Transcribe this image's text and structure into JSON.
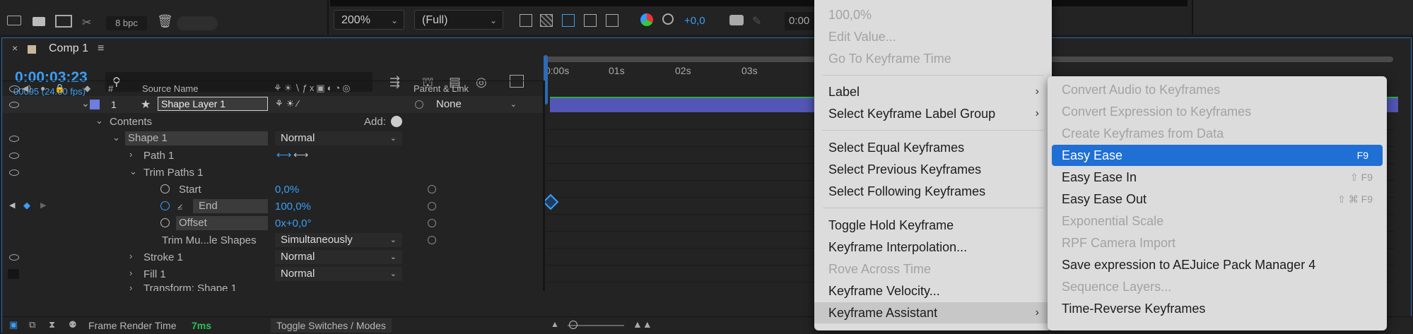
{
  "toolbar": {
    "bpc": "8 bpc",
    "zoom": "200%",
    "resolution": "(Full)",
    "exposure": "+0,0",
    "timecode_short": "0:00"
  },
  "comp": {
    "tab_title": "Comp 1",
    "timecode": "0:00:03:23",
    "frame_info": "00095 (24.00 fps)",
    "search_placeholder": "",
    "ruler_labels": [
      "0:00s",
      "01s",
      "02s",
      "03s"
    ],
    "headers": {
      "num": "#",
      "source_name": "Source Name",
      "parent_link": "Parent & Link"
    },
    "layer": {
      "number": "1",
      "name": "Shape Layer 1",
      "parent": "None"
    },
    "rows": {
      "contents": "Contents",
      "add": "Add:",
      "shape1": "Shape 1",
      "shape1_mode": "Normal",
      "path1": "Path 1",
      "trim_paths": "Trim Paths 1",
      "start": "Start",
      "start_val": "0,0%",
      "end": "End",
      "end_val": "100,0%",
      "offset": "Offset",
      "offset_val": "0x+0,0°",
      "trim_multiple": "Trim Mu...le Shapes",
      "trim_multiple_val": "Simultaneously",
      "stroke1": "Stroke 1",
      "stroke1_mode": "Normal",
      "fill1": "Fill 1",
      "fill1_mode": "Normal",
      "transform": "Transform: Shape 1"
    },
    "footer": {
      "render_label": "Frame Render Time",
      "render_value": "7ms",
      "toggle": "Toggle Switches / Modes"
    }
  },
  "context_menu": {
    "items": [
      {
        "label": "100,0%",
        "disabled": true
      },
      {
        "label": "Edit Value...",
        "disabled": true
      },
      {
        "label": "Go To Keyframe Time",
        "disabled": true
      },
      {
        "label": "Label",
        "submenu": true
      },
      {
        "label": "Select Keyframe Label Group",
        "submenu": true
      },
      {
        "label": "Select Equal Keyframes"
      },
      {
        "label": "Select Previous Keyframes"
      },
      {
        "label": "Select Following Keyframes"
      },
      {
        "label": "Toggle Hold Keyframe"
      },
      {
        "label": "Keyframe Interpolation..."
      },
      {
        "label": "Rove Across Time",
        "disabled": true
      },
      {
        "label": "Keyframe Velocity..."
      },
      {
        "label": "Keyframe Assistant",
        "submenu": true,
        "open": true
      }
    ]
  },
  "submenu": {
    "items": [
      {
        "label": "Convert Audio to Keyframes",
        "disabled": true
      },
      {
        "label": "Convert Expression to Keyframes",
        "disabled": true
      },
      {
        "label": "Create Keyframes from Data",
        "disabled": true
      },
      {
        "label": "Easy Ease",
        "shortcut": "F9",
        "highlighted": true
      },
      {
        "label": "Easy Ease In",
        "shortcut": "⇧ F9"
      },
      {
        "label": "Easy Ease Out",
        "shortcut": "⇧ ⌘ F9"
      },
      {
        "label": "Exponential Scale",
        "disabled": true
      },
      {
        "label": "RPF Camera Import",
        "disabled": true
      },
      {
        "label": "Save expression to AEJuice Pack Manager 4"
      },
      {
        "label": "Sequence Layers...",
        "disabled": true
      },
      {
        "label": "Time-Reverse Keyframes"
      }
    ]
  },
  "colors": {
    "accent": "#1f6fd4",
    "timecode": "#3a9ef5",
    "layer_bar": "#5356b4",
    "label_color": "#6f7ce0"
  }
}
